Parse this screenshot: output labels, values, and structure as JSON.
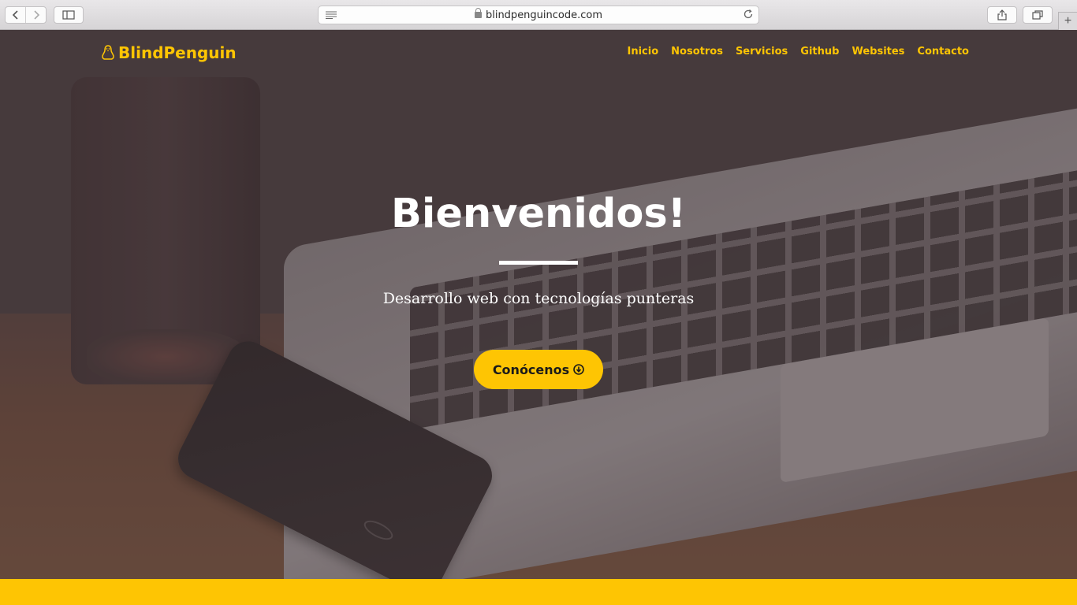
{
  "browser": {
    "url": "blindpenguincode.com"
  },
  "site": {
    "brand": "BlindPenguin",
    "menu": [
      "Inicio",
      "Nosotros",
      "Servicios",
      "Github",
      "Websites",
      "Contacto"
    ],
    "accent_color": "#fec503"
  },
  "hero": {
    "title": "Bienvenidos!",
    "subtitle": "Desarrollo web con tecnologías punteras",
    "cta_label": "Conócenos"
  },
  "icons": {
    "brand": "penguin-icon",
    "cta": "arrow-circle-down-icon"
  }
}
